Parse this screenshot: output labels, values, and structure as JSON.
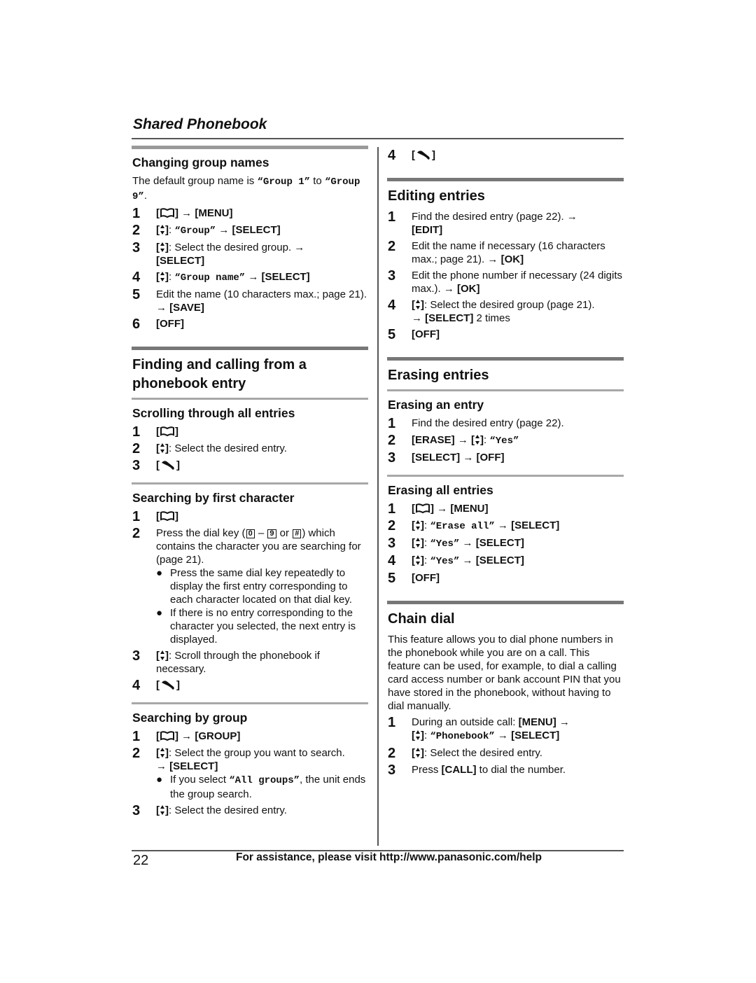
{
  "header": {
    "title": "Shared Phonebook"
  },
  "footer": {
    "page_number": "22",
    "assistance_text": "For assistance, please visit http://www.panasonic.com/help"
  },
  "icons": {
    "phonebook": "phonebook-icon",
    "updown": "up-down-navigator-icon",
    "talk": "talk-handset-icon",
    "arrow": "right-arrow"
  },
  "left": {
    "changing": {
      "heading": "Changing group names",
      "intro_pre": "The default group name is ",
      "intro_g1": "“Group 1”",
      "intro_mid": " to ",
      "intro_g9": "“Group 9”",
      "intro_end": ".",
      "steps": [
        {
          "n": "1",
          "k1": "[MENU]"
        },
        {
          "n": "2",
          "q": "“Group”",
          "k": "[SELECT]"
        },
        {
          "n": "3",
          "t": ": Select the desired group. →",
          "k": "[SELECT]"
        },
        {
          "n": "4",
          "q": "“Group name”",
          "k": "[SELECT]"
        },
        {
          "n": "5",
          "t": "Edit the name (10 characters max.; page 21). →",
          "k": "[SAVE]"
        },
        {
          "n": "6",
          "k": "[OFF]"
        }
      ]
    },
    "finding": {
      "heading": "Finding and calling from a phonebook entry"
    },
    "scrolling": {
      "heading": "Scrolling through all entries",
      "steps": [
        {
          "n": "1"
        },
        {
          "n": "2",
          "t": ": Select the desired entry."
        },
        {
          "n": "3"
        }
      ]
    },
    "first_char": {
      "heading": "Searching by first character",
      "steps": [
        {
          "n": "1"
        },
        {
          "n": "2",
          "t_pre": "Press the dial key (",
          "key0": "0",
          "dash": " – ",
          "key9": "9",
          "or": " or ",
          "keyhash": "#",
          "t_post": ") which contains the character you are searching for (page 21).",
          "bullets": [
            "Press the same dial key repeatedly to display the first entry corresponding to each character located on that dial key.",
            "If there is no entry corresponding to the character you selected, the next entry is displayed."
          ]
        },
        {
          "n": "3",
          "t": ": Scroll through the phonebook if necessary."
        },
        {
          "n": "4"
        }
      ]
    },
    "by_group": {
      "heading": "Searching by group",
      "steps": [
        {
          "n": "1",
          "k": "[GROUP]"
        },
        {
          "n": "2",
          "t": ": Select the group you want to search.",
          "k": "[SELECT]",
          "bullet_pre": "If you select ",
          "bullet_q": "“All groups”",
          "bullet_post": ", the unit ends the group search."
        },
        {
          "n": "3",
          "t": ": Select the desired entry."
        }
      ]
    }
  },
  "right": {
    "cont_step": {
      "n": "4"
    },
    "editing": {
      "heading": "Editing entries",
      "steps": [
        {
          "n": "1",
          "t": "Find the desired entry (page 22). →",
          "k": "[EDIT]"
        },
        {
          "n": "2",
          "t": "Edit the name if necessary (16 characters max.; page 21). →",
          "k": "[OK]"
        },
        {
          "n": "3",
          "t": "Edit the phone number if necessary (24 digits max.). →",
          "k": "[OK]"
        },
        {
          "n": "4",
          "t": ": Select the desired group (page 21).",
          "k": "[SELECT]",
          "t2": " 2 times"
        },
        {
          "n": "5",
          "k": "[OFF]"
        }
      ]
    },
    "erasing": {
      "heading": "Erasing entries"
    },
    "erase_one": {
      "heading": "Erasing an entry",
      "steps": [
        {
          "n": "1",
          "t": "Find the desired entry (page 22)."
        },
        {
          "n": "2",
          "k": "[ERASE]",
          "q": "“Yes”"
        },
        {
          "n": "3",
          "k": "[SELECT]",
          "k2": "[OFF]"
        }
      ]
    },
    "erase_all": {
      "heading": "Erasing all entries",
      "steps": [
        {
          "n": "1",
          "k": "[MENU]"
        },
        {
          "n": "2",
          "q": "“Erase all”",
          "k": "[SELECT]"
        },
        {
          "n": "3",
          "q": "“Yes”",
          "k": "[SELECT]"
        },
        {
          "n": "4",
          "q": "“Yes”",
          "k": "[SELECT]"
        },
        {
          "n": "5",
          "k": "[OFF]"
        }
      ]
    },
    "chain": {
      "heading": "Chain dial",
      "intro": "This feature allows you to dial phone numbers in the phonebook while you are on a call. This feature can be used, for example, to dial a calling card access number or bank account PIN that you have stored in the phonebook, without having to dial manually.",
      "steps": [
        {
          "n": "1",
          "t": "During an outside call: ",
          "k": "[MENU]",
          "q": "“Phonebook”",
          "k2": "[SELECT]"
        },
        {
          "n": "2",
          "t": ": Select the desired entry."
        },
        {
          "n": "3",
          "t_pre": "Press ",
          "k": "[CALL]",
          "t_post": " to dial the number."
        }
      ]
    }
  }
}
